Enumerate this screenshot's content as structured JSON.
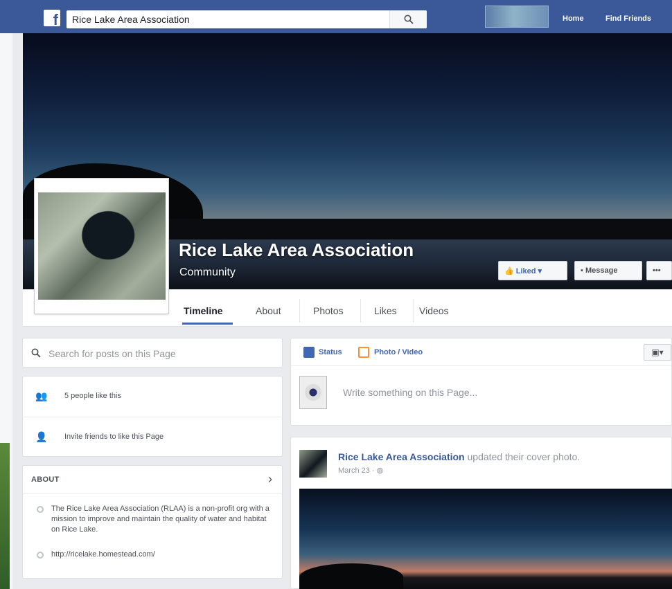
{
  "topbar": {
    "search_value": "Rice Lake Area Association",
    "nav": [
      "Home",
      "Find Friends"
    ]
  },
  "page": {
    "name": "Rice Lake Area Association",
    "category": "Community"
  },
  "cover_buttons": {
    "liked": "Liked ▾",
    "message": "Message",
    "more": "•••"
  },
  "tabs": [
    "Timeline",
    "About",
    "Photos",
    "Likes",
    "Videos"
  ],
  "left": {
    "search_placeholder": "Search for posts on this Page",
    "likes_count": "5 people like this",
    "invite": "Invite friends to like this Page",
    "about_heading": "ABOUT",
    "about_description": "The Rice Lake Area Association (RLAA) is a non-profit org with a mission to improve and maintain the quality of water and habitat on Rice Lake.",
    "website": "http://ricelake.homestead.com/"
  },
  "composer": {
    "status_label": "Status",
    "photo_label": "Photo / Video",
    "placeholder": "Write something on this Page..."
  },
  "post": {
    "author": "Rice Lake Area Association",
    "action": " updated their cover photo.",
    "time": "March 23 · "
  },
  "colors": {
    "brand": "#3b5998",
    "link": "#4267b2"
  }
}
